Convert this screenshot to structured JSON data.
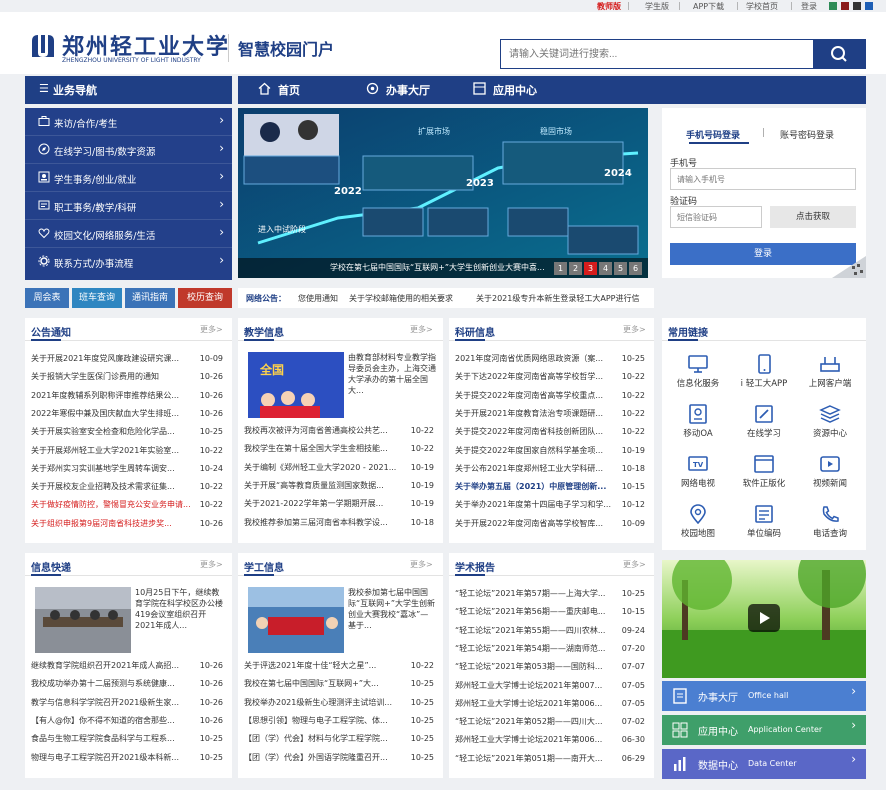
{
  "topbar": {
    "items": [
      "教师版",
      "学生版",
      "APP下载",
      "学校首页",
      "登录"
    ],
    "active_color": "#d51d1d"
  },
  "header": {
    "school_name_cn": "郑州轻工业大学",
    "school_name_en": "ZHENGZHOU UNIVERSITY OF LIGHT INDUSTRY",
    "portal_title": "智慧校园门户",
    "search_placeholder": "请输入关键词进行搜索...",
    "brand_color": "#1f3f85"
  },
  "nav": {
    "left_label": "业务导航",
    "items": [
      "首页",
      "办事大厅",
      "应用中心"
    ]
  },
  "sidebar": {
    "items": [
      {
        "label": "来访/合作/考生",
        "icon": "briefcase-icon"
      },
      {
        "label": "在线学习/图书/数字资源",
        "icon": "compass-icon"
      },
      {
        "label": "学生事务/创业/就业",
        "icon": "student-icon"
      },
      {
        "label": "职工事务/教学/科研",
        "icon": "card-icon"
      },
      {
        "label": "校园文化/网络服务/生活",
        "icon": "heart-icon"
      },
      {
        "label": "联系方式/办事流程",
        "icon": "gear-icon"
      }
    ]
  },
  "quick": [
    {
      "label": "周会表",
      "color": "#3b73b8"
    },
    {
      "label": "班车查询",
      "color": "#2e86c1"
    },
    {
      "label": "通讯指南",
      "color": "#3b73b8"
    },
    {
      "label": "校历查询",
      "color": "#c0392b"
    }
  ],
  "banner": {
    "caption": "学校在第七届中国国际“互联网+”大学生创新创业大赛中喜...",
    "pages": [
      "1",
      "2",
      "3",
      "4",
      "5",
      "6"
    ],
    "active_page": "3",
    "timeline_labels": [
      "扩展市场",
      "稳固市场",
      "2022",
      "2023",
      "2024",
      "进入中试阶段"
    ]
  },
  "notice": {
    "label": "网络公告：",
    "items": [
      "您使用通知",
      "关于学校邮箱使用的相关要求",
      "关于2021级专升本新生登录轻工大APP进行信"
    ]
  },
  "login": {
    "tab_phone": "手机号码登录",
    "tab_account": "账号密码登录",
    "phone_label": "手机号",
    "phone_placeholder": "请输入手机号",
    "code_label": "验证码",
    "code_placeholder": "短信验证码",
    "get_code": "点击获取",
    "submit": "登录"
  },
  "panels": {
    "gonggao": {
      "title": "公告通知",
      "more": "更多>",
      "rows": [
        {
          "t": "关于开展2021年度党风廉政建设研究课...",
          "d": "10-09"
        },
        {
          "t": "关于报销大学生医保门诊费用的通知",
          "d": "10-26"
        },
        {
          "t": "2021年度教辅系列职称评审推荐结果公...",
          "d": "10-26"
        },
        {
          "t": "2022年寒假中兼及国庆献血大学生排班...",
          "d": "10-26"
        },
        {
          "t": "关于开展实验室安全检查和危险化学品...",
          "d": "10-25"
        },
        {
          "t": "关于开展郑州轻工业大学2021年实验室...",
          "d": "10-22"
        },
        {
          "t": "关于郑州实习实训基地学生周转车调安...",
          "d": "10-24"
        },
        {
          "t": "关于开展校友企业招聘及技术需求征集...",
          "d": "10-22"
        },
        {
          "t": "关于做好疫情防控，警惕冒充公安业务申请...",
          "d": "10-22",
          "red": true
        },
        {
          "t": "关于组织申报第9届河南省科技进步奖...",
          "d": "10-26",
          "red": true
        }
      ]
    },
    "jiaoxue": {
      "title": "教学信息",
      "more": "更多>",
      "feature": "由教育部材料专业教学指导委员会主办，上海交通大学承办的第十届全国大...",
      "rows": [
        {
          "t": "我校再次被评为河南省普通高校公共艺...",
          "d": "10-22"
        },
        {
          "t": "我校学生在第十届全国大学生金相技能...",
          "d": "10-22"
        },
        {
          "t": "关于编制《郑州轻工业大学2020 - 2021...",
          "d": "10-19"
        },
        {
          "t": "关于开展“高等教育质量监测国家数据...",
          "d": "10-19"
        },
        {
          "t": "关于2021-2022学年第一学期期开展...",
          "d": "10-19"
        },
        {
          "t": "我校推荐参加第三届河南省本科教学设...",
          "d": "10-18"
        }
      ]
    },
    "keyan": {
      "title": "科研信息",
      "more": "更多>",
      "rows": [
        {
          "t": "2021年度河南省优质网络思政资源（案...",
          "d": "10-25"
        },
        {
          "t": "关于下达2022年度河南省高等学校哲学...",
          "d": "10-22"
        },
        {
          "t": "关于提交2022年度河南省高等学校重点...",
          "d": "10-22"
        },
        {
          "t": "关于开展2021年度教育法治专项课题研...",
          "d": "10-22"
        },
        {
          "t": "关于提交2022年度河南省科技创新团队...",
          "d": "10-22"
        },
        {
          "t": "关于提交2022年度国家自然科学基金项...",
          "d": "10-19"
        },
        {
          "t": "关于公布2021年度郑州轻工业大学科研...",
          "d": "10-18"
        },
        {
          "t": "关于举办第五届（2021）中原管理创新...",
          "d": "10-15",
          "blue": true
        },
        {
          "t": "关于举办2021年度第十四届电子学习和学...",
          "d": "10-12"
        },
        {
          "t": "关于开展2022年度河南省高等学校智库...",
          "d": "10-09"
        }
      ]
    },
    "xinxi": {
      "title": "信息快递",
      "more": "更多>",
      "feature": "10月25日下午，继续教育学院在科学校区办公楼419会议室组织召开2021年成人...",
      "rows": [
        {
          "t": "继续教育学院组织召开2021年成人高招...",
          "d": "10-26"
        },
        {
          "t": "我校成功举办第十二届预测与系统健康...",
          "d": "10-26"
        },
        {
          "t": "教学与信息科学学院召开2021级新生家...",
          "d": "10-26"
        },
        {
          "t": "【有人@你】你不得不知道的宿舍那些...",
          "d": "10-26"
        },
        {
          "t": "食品与生物工程学院食品科学与工程系...",
          "d": "10-25"
        },
        {
          "t": "物理与电子工程学院召开2021级本科新...",
          "d": "10-25"
        }
      ]
    },
    "xuegong": {
      "title": "学工信息",
      "more": "更多>",
      "feature": "我校参加第七届中国国际“互联网+”大学生创新创业大赛我校“嘉冰”—基于...",
      "rows": [
        {
          "t": "关于评选2021年度十佳“轻大之星”...",
          "d": "10-22"
        },
        {
          "t": "我校在第七届中国国际“互联网+”大...",
          "d": "10-25"
        },
        {
          "t": "我校举办2021级新生心理测评主试培训...",
          "d": "10-25"
        },
        {
          "t": "【思想引领】物理与电子工程学院、体...",
          "d": "10-25"
        },
        {
          "t": "【团（学）代会】材料与化学工程学院...",
          "d": "10-25"
        },
        {
          "t": "【团（学）代会】外国语学院隆重召开...",
          "d": "10-25"
        }
      ]
    },
    "xueshu": {
      "title": "学术报告",
      "more": "更多>",
      "rows": [
        {
          "t": "“轻工论坛”2021年第57期——上海大学...",
          "d": "10-25"
        },
        {
          "t": "“轻工论坛”2021年第56期——重庆邮电...",
          "d": "10-15"
        },
        {
          "t": "“轻工论坛”2021年第55期——四川农林...",
          "d": "09-24"
        },
        {
          "t": "“轻工论坛”2021年第54期——湖南师范...",
          "d": "07-20"
        },
        {
          "t": "“轻工论坛”2021年第053期——国防科...",
          "d": "07-07"
        },
        {
          "t": "郑州轻工业大学博士论坛2021年第007...",
          "d": "07-05"
        },
        {
          "t": "郑州轻工业大学博士论坛2021年第006...",
          "d": "07-05"
        },
        {
          "t": "“轻工论坛”2021年第052期——四川大...",
          "d": "07-02"
        },
        {
          "t": "郑州轻工业大学博士论坛2021年第006...",
          "d": "06-30"
        },
        {
          "t": "“轻工论坛”2021年第051期——南开大...",
          "d": "06-29"
        }
      ]
    },
    "links": {
      "title": "常用链接",
      "more": "更多>",
      "items": [
        {
          "label": "信息化服务",
          "icon": "monitor-icon"
        },
        {
          "label": "i 轻工大APP",
          "icon": "phone-icon"
        },
        {
          "label": "上网客户端",
          "icon": "router-icon"
        },
        {
          "label": "移动OA",
          "icon": "id-card-icon"
        },
        {
          "label": "在线学习",
          "icon": "pencil-icon"
        },
        {
          "label": "资源中心",
          "icon": "layers-icon"
        },
        {
          "label": "网络电视",
          "icon": "tv-icon"
        },
        {
          "label": "软件正版化",
          "icon": "window-icon"
        },
        {
          "label": "视频新闻",
          "icon": "video-icon"
        },
        {
          "label": "校园地图",
          "icon": "map-pin-icon"
        },
        {
          "label": "单位编码",
          "icon": "list-icon"
        },
        {
          "label": "电话查询",
          "icon": "telephone-icon"
        }
      ]
    }
  },
  "services": [
    {
      "label_cn": "办事大厅",
      "label_en": "Office hall",
      "color": "#4b7fd1"
    },
    {
      "label_cn": "应用中心",
      "label_en": "Application Center",
      "color": "#3f9f6a"
    },
    {
      "label_cn": "数据中心",
      "label_en": "Data Center",
      "color": "#5a67c7"
    }
  ]
}
